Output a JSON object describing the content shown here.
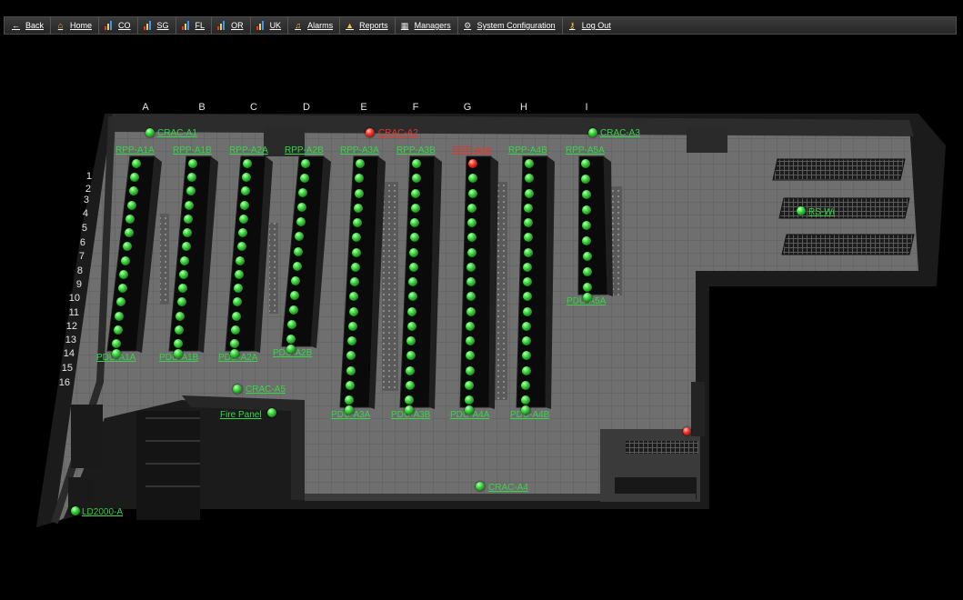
{
  "nav": {
    "back": "Back",
    "home": "Home",
    "sites": [
      "CO",
      "SG",
      "FL",
      "OR",
      "UK"
    ],
    "alarms": "Alarms",
    "reports": "Reports",
    "managers": "Managers",
    "system_configuration": "System Configuration",
    "log_out": "Log Out"
  },
  "floor": {
    "column_labels": [
      "A",
      "B",
      "C",
      "D",
      "E",
      "F",
      "G",
      "H",
      "I"
    ],
    "row_labels": [
      "1",
      "2",
      "3",
      "4",
      "5",
      "6",
      "7",
      "8",
      "9",
      "10",
      "11",
      "12",
      "13",
      "14",
      "15",
      "16"
    ],
    "crac_units": [
      {
        "name": "CRAC-A1",
        "status": "ok"
      },
      {
        "name": "CRAC-A2",
        "status": "alarm"
      },
      {
        "name": "CRAC-A3",
        "status": "ok"
      },
      {
        "name": "CRAC-A4",
        "status": "ok"
      },
      {
        "name": "CRAC-A5",
        "status": "ok"
      }
    ],
    "rpp_units": [
      {
        "name": "RPP-A1A",
        "status": "ok"
      },
      {
        "name": "RPP-A1B",
        "status": "ok"
      },
      {
        "name": "RPP-A2A",
        "status": "ok"
      },
      {
        "name": "RPP-A2B",
        "status": "ok"
      },
      {
        "name": "RPP-A3A",
        "status": "ok"
      },
      {
        "name": "RPP-A3B",
        "status": "ok"
      },
      {
        "name": "RPP-A4A",
        "status": "alarm"
      },
      {
        "name": "RPP-A4B",
        "status": "ok"
      },
      {
        "name": "RPP-A5A",
        "status": "ok"
      }
    ],
    "pdu_units": [
      {
        "name": "PDU-A1A",
        "status": "ok"
      },
      {
        "name": "PDU-A1B",
        "status": "ok"
      },
      {
        "name": "PDU-A2A",
        "status": "ok"
      },
      {
        "name": "PDU-A2B",
        "status": "ok"
      },
      {
        "name": "PDU-A3A",
        "status": "ok"
      },
      {
        "name": "PDU-A3B",
        "status": "ok"
      },
      {
        "name": "PDU-A4A",
        "status": "ok"
      },
      {
        "name": "PDU-A4B",
        "status": "ok"
      },
      {
        "name": "PDU-A5A",
        "status": "ok"
      }
    ],
    "other_devices": [
      {
        "name": "RS-Wi",
        "status": "ok"
      },
      {
        "name": "Fire Panel",
        "status": "ok"
      },
      {
        "name": "LD2000-A",
        "status": "ok"
      }
    ]
  },
  "colors": {
    "ok": "#35d648",
    "alarm": "#e8342c",
    "navbar": "#2e2e2e",
    "floor": "#6e6e6e"
  },
  "icons": {
    "back": "left-arrow-icon",
    "home": "house-icon",
    "site": "bar-chart-icon",
    "alarms": "bell-icon",
    "reports": "triangle-icon",
    "managers": "calendar-grid-icon",
    "system_configuration": "gears-icon",
    "log_out": "key-icon"
  }
}
